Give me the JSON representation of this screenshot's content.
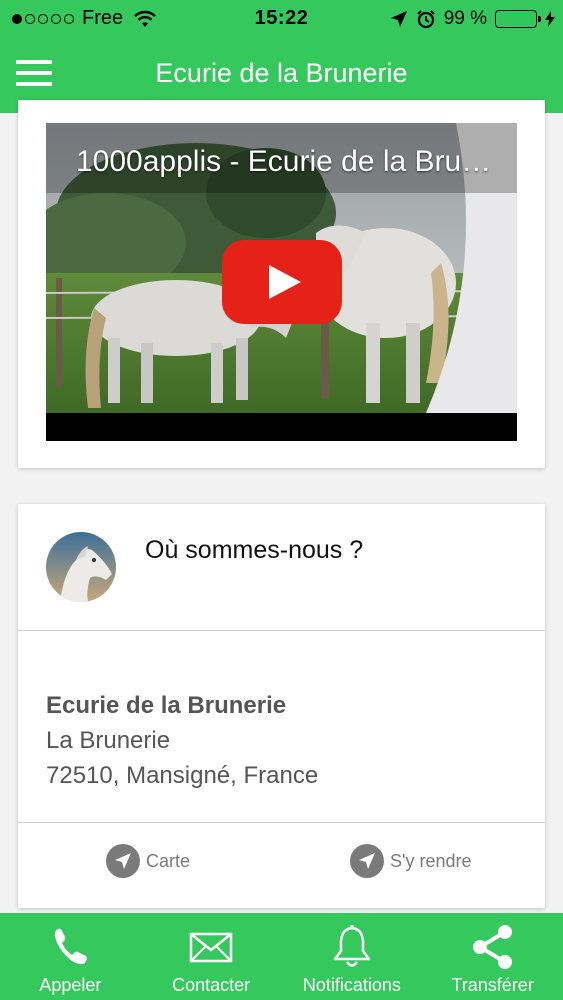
{
  "status_bar": {
    "carrier": "Free",
    "time": "15:22",
    "battery": "99 %",
    "battery_level": 0.99
  },
  "nav": {
    "title": "Ecurie de la Brunerie",
    "menu_icon": "hamburger-menu-icon"
  },
  "video": {
    "title": "1000applis - Ecurie de la Bru…",
    "play_icon": "youtube-play-icon"
  },
  "location": {
    "heading": "Où sommes-nous ?",
    "address": {
      "name": "Ecurie de la Brunerie",
      "line1": "La Brunerie",
      "line2": "72510, Mansigné, France"
    },
    "actions": [
      {
        "label": "Carte",
        "icon": "navigation-arrow-icon"
      },
      {
        "label": "S'y rendre",
        "icon": "navigation-arrow-icon"
      }
    ]
  },
  "tabs": [
    {
      "label": "Appeler",
      "icon": "phone-icon"
    },
    {
      "label": "Contacter",
      "icon": "envelope-icon"
    },
    {
      "label": "Notifications",
      "icon": "bell-icon"
    },
    {
      "label": "Transférer",
      "icon": "share-icon"
    }
  ],
  "colors": {
    "primary": "#35c95d",
    "youtube_red": "#e62117",
    "text_gray": "#555555",
    "icon_gray": "#7a7a7a"
  }
}
